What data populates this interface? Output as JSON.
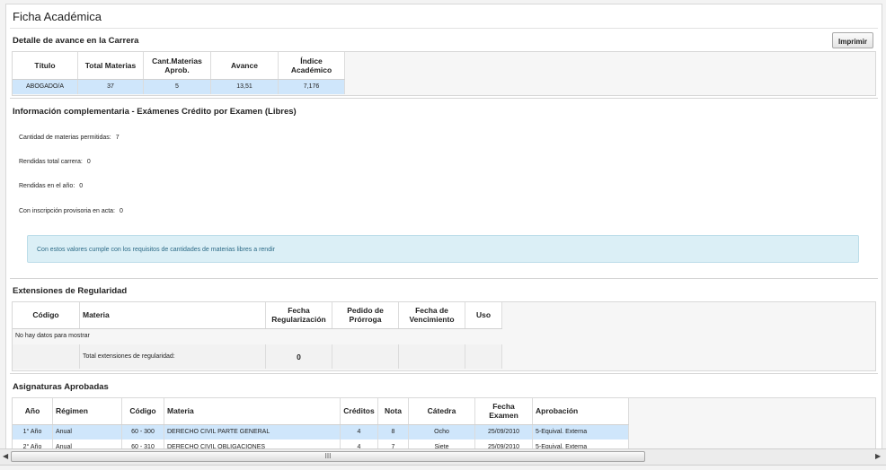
{
  "page": {
    "title": "Ficha Académica",
    "print_label": "Imprimir"
  },
  "career": {
    "section_title": "Detalle de avance en la Carrera",
    "columns": [
      "Título",
      "Total Materias",
      "Cant.Materias Aprob.",
      "Avance",
      "Índice Académico"
    ],
    "row": {
      "titulo": "ABOGADO/A",
      "total": "37",
      "aprobadas": "5",
      "avance": "13,51",
      "indice": "7,176"
    }
  },
  "exams": {
    "section_title": "Información complementaria - Exámenes Crédito por Examen (Libres)",
    "items": [
      {
        "label": "Cantidad de materias permitidas:",
        "value": "7"
      },
      {
        "label": "Rendidas total carrera:",
        "value": "0"
      },
      {
        "label": "Rendidas en el año:",
        "value": "0"
      },
      {
        "label": "Con inscripción provisoria en acta:",
        "value": "0"
      }
    ],
    "notice": "Con estos valores cumple con los requisitos de cantidades de materias libres a rendir"
  },
  "extensions": {
    "section_title": "Extensiones de Regularidad",
    "columns": [
      "Código",
      "Materia",
      "Fecha Regularización",
      "Pedido de Prórroga",
      "Fecha de Vencimiento",
      "Uso"
    ],
    "empty_text": "No hay datos para mostrar",
    "total_label": "Total extensiones de regularidad:",
    "total_value": "0"
  },
  "approved": {
    "section_title": "Asignaturas Aprobadas",
    "columns": [
      "Año",
      "Régimen",
      "Código",
      "Materia",
      "Créditos",
      "Nota",
      "Cátedra",
      "Fecha Examen",
      "Aprobación"
    ],
    "rows": [
      {
        "anio": "1° Año",
        "regimen": "Anual",
        "codigo": "60 - 300",
        "materia": "DERECHO CIVIL PARTE GENERAL",
        "creditos": "4",
        "nota": "8",
        "catedra": "Ocho",
        "fecha": "25/09/2010",
        "aprobacion": "5-Equival. Externa"
      },
      {
        "anio": "2° Año",
        "regimen": "Anual",
        "codigo": "60 - 310",
        "materia": "DERECHO CIVIL OBLIGACIONES",
        "creditos": "4",
        "nota": "7",
        "catedra": "Siete",
        "fecha": "25/09/2010",
        "aprobacion": "5-Equival. Externa"
      }
    ]
  },
  "scrollbar": {
    "grip": "III"
  }
}
